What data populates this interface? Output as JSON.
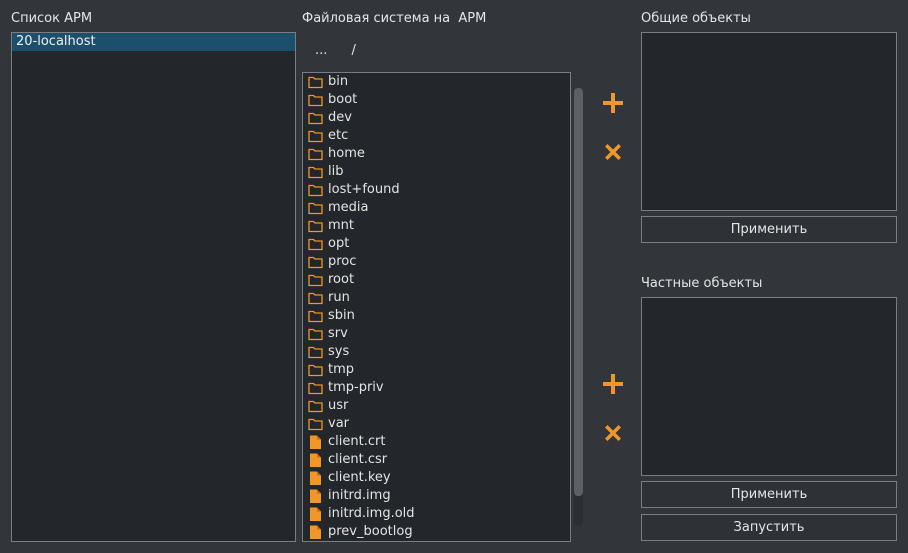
{
  "workstations": {
    "title": "Список АРМ",
    "items": [
      {
        "label": "20-localhost",
        "selected": true
      }
    ]
  },
  "filesystem": {
    "title": "Файловая система на  АРМ",
    "nav_up": "...",
    "current_path": "/",
    "entries": [
      {
        "name": "bin",
        "type": "folder"
      },
      {
        "name": "boot",
        "type": "folder"
      },
      {
        "name": "dev",
        "type": "folder"
      },
      {
        "name": "etc",
        "type": "folder"
      },
      {
        "name": "home",
        "type": "folder"
      },
      {
        "name": "lib",
        "type": "folder"
      },
      {
        "name": "lost+found",
        "type": "folder"
      },
      {
        "name": "media",
        "type": "folder"
      },
      {
        "name": "mnt",
        "type": "folder"
      },
      {
        "name": "opt",
        "type": "folder"
      },
      {
        "name": "proc",
        "type": "folder"
      },
      {
        "name": "root",
        "type": "folder"
      },
      {
        "name": "run",
        "type": "folder"
      },
      {
        "name": "sbin",
        "type": "folder"
      },
      {
        "name": "srv",
        "type": "folder"
      },
      {
        "name": "sys",
        "type": "folder"
      },
      {
        "name": "tmp",
        "type": "folder"
      },
      {
        "name": "tmp-priv",
        "type": "folder"
      },
      {
        "name": "usr",
        "type": "folder"
      },
      {
        "name": "var",
        "type": "folder"
      },
      {
        "name": "client.crt",
        "type": "file"
      },
      {
        "name": "client.csr",
        "type": "file"
      },
      {
        "name": "client.key",
        "type": "file"
      },
      {
        "name": "initrd.img",
        "type": "file"
      },
      {
        "name": "initrd.img.old",
        "type": "file"
      },
      {
        "name": "prev_bootlog",
        "type": "file"
      }
    ]
  },
  "common_objects": {
    "title": "Общие объекты",
    "apply_label": "Применить"
  },
  "private_objects": {
    "title": "Частные объекты",
    "apply_label": "Применить"
  },
  "run_label": "Запустить",
  "icons": {
    "add": "plus-icon",
    "remove": "x-icon",
    "folder": "folder-icon",
    "file": "file-icon"
  },
  "colors": {
    "accent": "#f0962a",
    "selection": "#1c4f6b",
    "background": "#32353a",
    "panel": "#23262a"
  }
}
